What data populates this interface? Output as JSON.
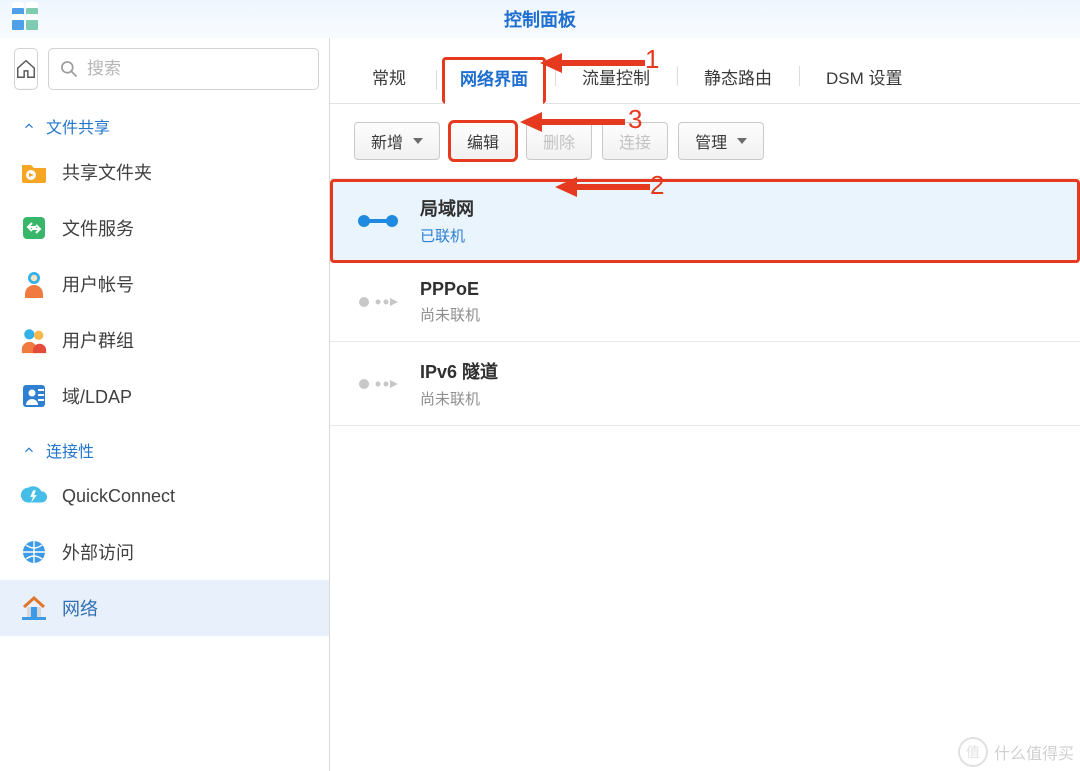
{
  "header": {
    "title": "控制面板"
  },
  "search": {
    "placeholder": "搜索"
  },
  "sidebar": {
    "sections": [
      {
        "title": "文件共享",
        "items": [
          {
            "id": "shared-folder",
            "label": "共享文件夹"
          },
          {
            "id": "file-services",
            "label": "文件服务"
          },
          {
            "id": "user-accounts",
            "label": "用户帐号"
          },
          {
            "id": "user-groups",
            "label": "用户群组"
          },
          {
            "id": "domain-ldap",
            "label": "域/LDAP"
          }
        ]
      },
      {
        "title": "连接性",
        "items": [
          {
            "id": "quickconnect",
            "label": "QuickConnect"
          },
          {
            "id": "external-access",
            "label": "外部访问"
          },
          {
            "id": "network",
            "label": "网络",
            "active": true
          }
        ]
      }
    ]
  },
  "tabs": [
    {
      "id": "general",
      "label": "常规"
    },
    {
      "id": "network-interface",
      "label": "网络界面",
      "active": true
    },
    {
      "id": "traffic-control",
      "label": "流量控制"
    },
    {
      "id": "static-route",
      "label": "静态路由"
    },
    {
      "id": "dsm-settings",
      "label": "DSM 设置"
    }
  ],
  "toolbar": {
    "add": "新增",
    "edit": "编辑",
    "delete": "删除",
    "connect": "连接",
    "manage": "管理"
  },
  "interfaces": [
    {
      "id": "lan",
      "name": "局域网",
      "status": "已联机",
      "connected": true,
      "selected": true
    },
    {
      "id": "pppoe",
      "name": "PPPoE",
      "status": "尚未联机",
      "connected": false,
      "selected": false
    },
    {
      "id": "ipv6t",
      "name": "IPv6 隧道",
      "status": "尚未联机",
      "connected": false,
      "selected": false
    }
  ],
  "annotations": {
    "n1": "1",
    "n2": "2",
    "n3": "3"
  },
  "watermark": {
    "text": "什么值得买",
    "badge": "值"
  }
}
